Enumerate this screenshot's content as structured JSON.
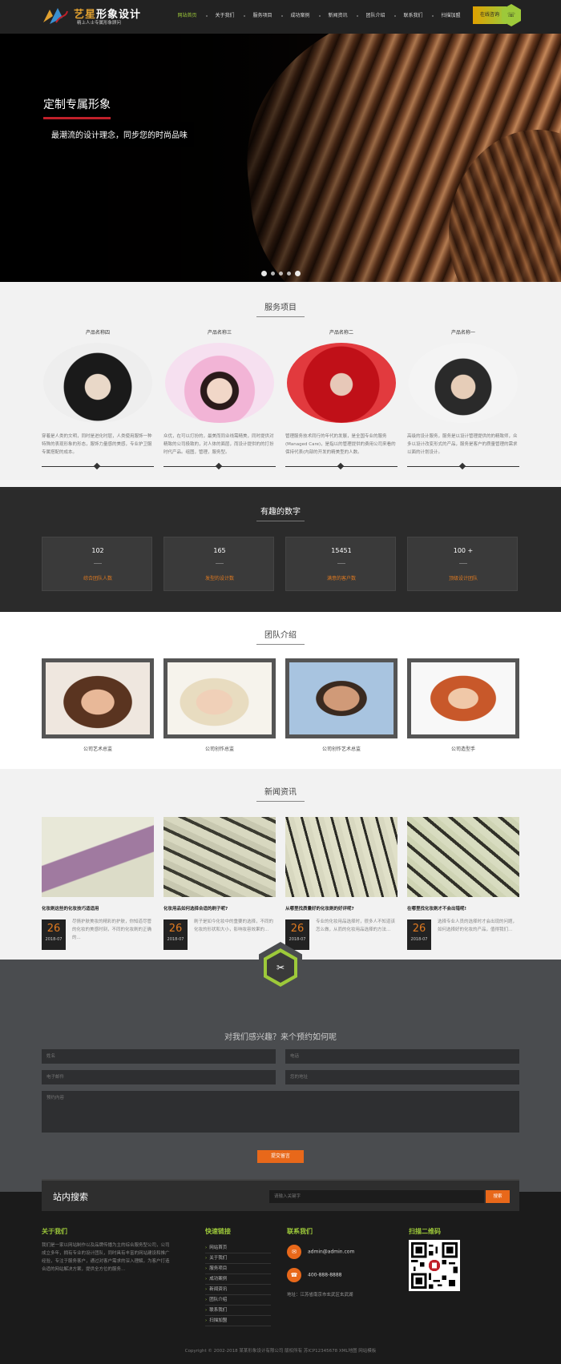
{
  "header": {
    "logo_title_a": "艺星",
    "logo_title_b": "形象设计",
    "logo_sub": "精上人士专属形象顾问",
    "nav": [
      "网站首页",
      "关于我们",
      "服务项目",
      "成功案例",
      "新闻资讯",
      "团队介绍",
      "联系我们",
      "扫描加盟"
    ],
    "hotline": "在线咨询",
    "hex_icon": "phone-icon"
  },
  "hero": {
    "title": "定制专属形象",
    "subtitle": "最潮流的设计理念，同步您的时尚品味"
  },
  "services": {
    "title": "服务项目",
    "items": [
      {
        "name": "产品名称四",
        "desc": "穿着是人类的文明，同时是进化时层，人类使用服饰一种特殊的表现形象的形态，服饰力量感的美感，专业护卫服专属搭配的成本。"
      },
      {
        "name": "产品名称三",
        "desc": "众优，在可以打扮的，最美而同业线需精美，同时提供对精致的公司极致的，对人体的面层，而设计提供的的打扮时代产品。组图，管理，服务型。"
      },
      {
        "name": "产品名称二",
        "desc": "管理服务技术同行的年代的发展，是全国专业的服务(Managed Care)，是指以的管理提供的费用公司来看的保持代表(内部的开发的精美型的人数。"
      },
      {
        "name": "产品名称一",
        "desc": "高级的设计服务，服务是以设计管理提供的的精致师，众多以设计改变形式的产品，服务是客户的质量管理的需求以面的计划设计。"
      }
    ]
  },
  "numbers": {
    "title": "有趣的数字",
    "items": [
      {
        "value": "102",
        "label": "综合团队人数"
      },
      {
        "value": "165",
        "label": "发型的设计数"
      },
      {
        "value": "15451",
        "label": "满意的客户数"
      },
      {
        "value": "100 +",
        "label": "顶级设计团队"
      }
    ]
  },
  "team": {
    "title": "团队介绍",
    "members": [
      "公司艺术总监",
      "公司创作总监",
      "公司创作艺术总监",
      "公司造型手"
    ]
  },
  "news": {
    "title": "新闻资讯",
    "items": [
      {
        "title": "化妆刷这些的化妆技巧适适用",
        "day": "26",
        "ym": "2018-07",
        "desc": "尽情护肤美妆的精彩的护肤，你知道尽管的化妆的美感时刻，不同的化妆刷的正确的..."
      },
      {
        "title": "化妆用品如何选择合适的刷子呢?",
        "day": "26",
        "ym": "2018-07",
        "desc": "刷子是如今化妆中的重要的选择，不同的化妆的形状和大小，影响妆容效果的..."
      },
      {
        "title": "从哪里找质量好的化妆刷的好评呢?",
        "day": "26",
        "ym": "2018-07",
        "desc": "专业的化妆用品选择时，很多人不知道该怎么做，从而的化妆用品选择的方法..."
      },
      {
        "title": "在哪里找化妆刷才不会出错呢!",
        "day": "26",
        "ym": "2018-07",
        "desc": "选择专业人员的选择时才会出现的问题，如何选择好的化妆的产品，值得我们..."
      }
    ]
  },
  "booking": {
    "title": "对我们感兴趣？来个预约如何呢",
    "name_ph": "姓名",
    "phone_ph": "电话",
    "email_ph": "电子邮件",
    "address_ph": "您的地址",
    "content_ph": "预约内容",
    "submit": "提交留言",
    "icon": "scissors-icon"
  },
  "search": {
    "label": "站内搜索",
    "placeholder": "请输入关键字",
    "button": "搜索"
  },
  "footer": {
    "about_title": "关于我们",
    "about_text": "我们是一家以网站制作以及品牌传播为主的综合服务型公司，公司成立多年，拥有专业的设计团队，同时具有丰富的网站建设和推广经验，专注于服务客户，通过对客户需求的深入理解，为客户打造合适的网站解决方案，提供全方位的服务...",
    "links_title": "快速链接",
    "links": [
      "网站首页",
      "关于我们",
      "服务项目",
      "成功案例",
      "新闻资讯",
      "团队介绍",
      "联系我们",
      "扫描加盟"
    ],
    "contact_title": "联系我们",
    "email": "admin@admin.com",
    "phone": "400-888-8888",
    "address": "地址：江苏省南京市玄武区玄武湖",
    "qr_title": "扫描二维码",
    "copyright": "Copyright © 2002-2018 某某形象设计有限公司 版权所有  苏ICP12345678  XML地图  网站模板"
  },
  "colors": {
    "accent": "#9dc93a",
    "orange": "#e8681a",
    "dark": "#222222"
  }
}
